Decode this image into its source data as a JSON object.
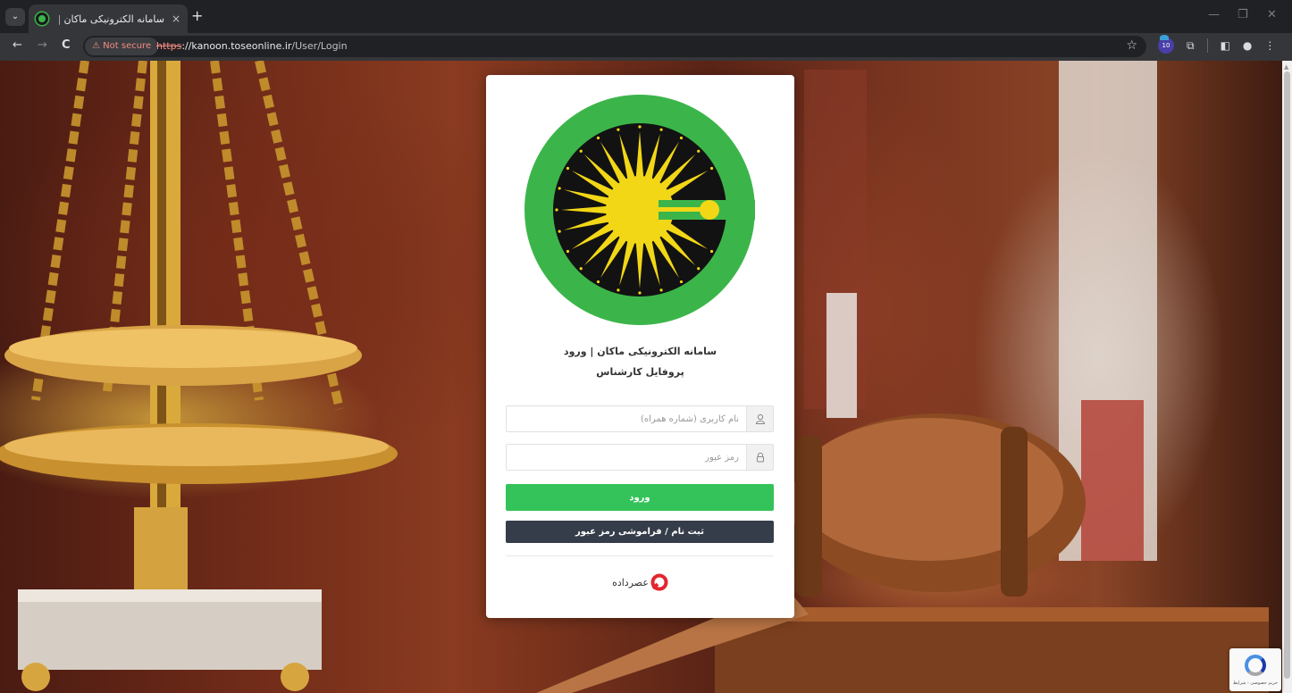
{
  "browser": {
    "tab_title": "سامانه الکترونیکی ماکان | ورود",
    "tab_close": "×",
    "new_tab": "+",
    "security_chip": "Not secure",
    "url_scheme": "https",
    "url_host": "://kanoon.toseonline.ir",
    "url_path": "/User/Login",
    "extension_badge": "10",
    "icons": [
      "tab-menu-icon",
      "back-icon",
      "forward-icon",
      "reload-icon",
      "warning-icon",
      "star-icon",
      "extensions-icon",
      "sidepanel-icon",
      "profile-icon",
      "menu-icon",
      "minimize-icon",
      "maximize-icon",
      "close-window-icon"
    ]
  },
  "login": {
    "title": "سامانه الکترونیکی ماکان | ورود",
    "subtitle": "پروفایل کارشناس",
    "username_placeholder": "نام کاربری (شماره همراه)",
    "password_placeholder": "رمز عبور",
    "login_button": "ورود",
    "register_button": "ثبت نام / فراموشی رمز عبور",
    "brand_name": "عصرداده"
  },
  "recaptcha": {
    "caption": "حریم خصوصی - شرایط"
  },
  "colors": {
    "accent_green": "#34c35a",
    "dark_button": "#353d4a",
    "logo_green": "#3bb54a",
    "logo_yellow": "#f2d716",
    "brand_red": "#e3262e"
  }
}
